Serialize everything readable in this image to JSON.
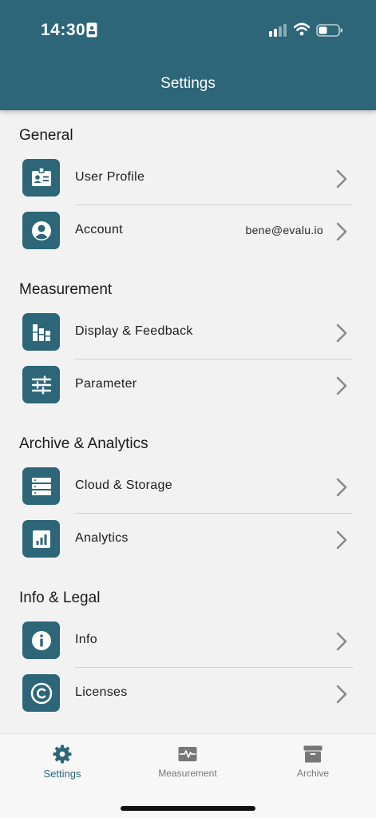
{
  "status_bar": {
    "time": "14:30",
    "icons": [
      "sim-card-icon",
      "signal-icon",
      "wifi-icon",
      "battery-icon"
    ]
  },
  "header": {
    "title": "Settings"
  },
  "colors": {
    "accent": "#2c6678",
    "background": "#f2f2f2",
    "chevron": "#8a8a8a"
  },
  "sections": [
    {
      "title": "General",
      "items": [
        {
          "label": "User Profile",
          "icon": "id-badge-icon",
          "value": ""
        },
        {
          "label": "Account",
          "icon": "account-circle-icon",
          "value": "bene@evalu.io"
        }
      ]
    },
    {
      "title": "Measurement",
      "items": [
        {
          "label": "Display & Feedback",
          "icon": "bar-chart-icon",
          "value": ""
        },
        {
          "label": "Parameter",
          "icon": "sliders-icon",
          "value": ""
        }
      ]
    },
    {
      "title": "Archive & Analytics",
      "items": [
        {
          "label": "Cloud & Storage",
          "icon": "server-icon",
          "value": ""
        },
        {
          "label": "Analytics",
          "icon": "analytics-icon",
          "value": ""
        }
      ]
    },
    {
      "title": "Info & Legal",
      "items": [
        {
          "label": "Info",
          "icon": "info-icon",
          "value": ""
        },
        {
          "label": "Licenses",
          "icon": "copyright-icon",
          "value": ""
        }
      ]
    }
  ],
  "tabs": [
    {
      "label": "Settings",
      "icon": "gear-icon",
      "active": true
    },
    {
      "label": "Measurement",
      "icon": "pulse-monitor-icon",
      "active": false
    },
    {
      "label": "Archive",
      "icon": "archive-box-icon",
      "active": false
    }
  ]
}
